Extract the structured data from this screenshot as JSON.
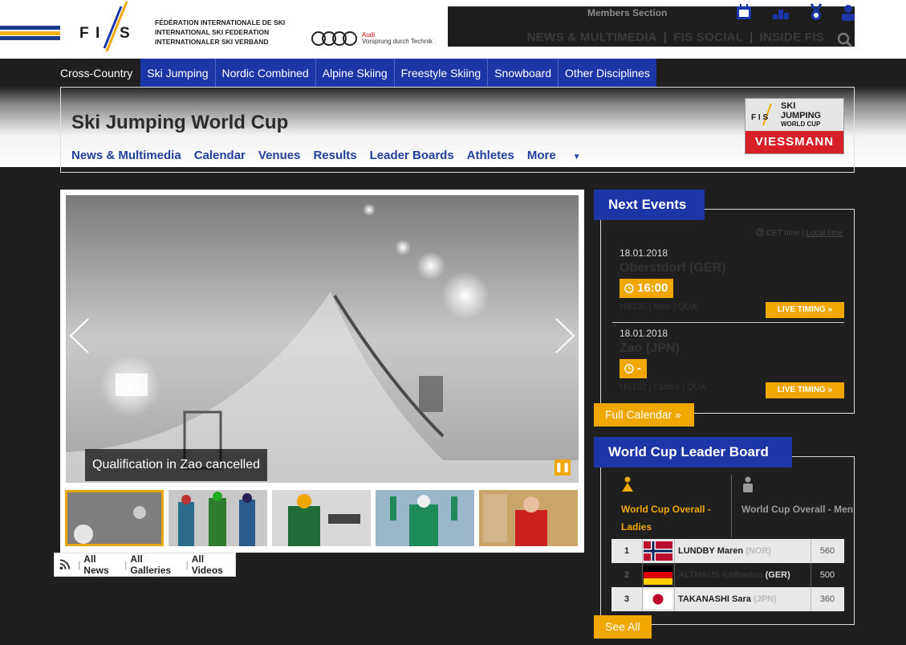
{
  "header": {
    "fis_lines": [
      "FÉDÉRATION INTERNATIONALE DE SKI",
      "INTERNATIONAL SKI FEDERATION",
      "INTERNATIONALER SKI VERBAND"
    ],
    "audi_name": "Audi",
    "audi_tagline": "Vorsprung durch Technik",
    "members_label": "Members Section",
    "top_nav": [
      "NEWS & MULTIMEDIA",
      "FIS SOCIAL",
      "INSIDE FIS"
    ],
    "top_icons": [
      "calendar-icon",
      "podium-icon",
      "medal-icon",
      "user-icon"
    ]
  },
  "disciplines": [
    "Cross-Country",
    "Ski Jumping",
    "Nordic Combined",
    "Alpine Skiing",
    "Freestyle Skiing",
    "Snowboard",
    "Other Disciplines"
  ],
  "series": {
    "title": "Ski Jumping World Cup",
    "nav": [
      "News & Multimedia",
      "Calendar",
      "Venues",
      "Results",
      "Leader Boards",
      "Athletes",
      "More"
    ],
    "sponsor": {
      "line1": "SKI",
      "line2": "JUMPING",
      "line3": "WORLD CUP",
      "brand": "VIESSMANN"
    }
  },
  "slider": {
    "caption": "Qualification in Zao cancelled",
    "links": [
      "All News",
      "All Galleries",
      "All Videos"
    ]
  },
  "next_events": {
    "title": "Next Events",
    "cet": "CET time",
    "local": "Local time",
    "events": [
      {
        "date": "18.01.2018",
        "place": "Oberstdorf (GER)",
        "time": "16:00",
        "meta": "HS235 | Men | QUA",
        "live": "LIVE TIMING »"
      },
      {
        "date": "18.01.2018",
        "place": "Zao (JPN)",
        "time": "-",
        "meta": "HS102 | Ladies | QUA",
        "live": "LIVE TIMING »"
      }
    ],
    "full_calendar": "Full Calendar »"
  },
  "leaderboard": {
    "title": "World Cup Leader Board",
    "tab_ladies": "World Cup Overall - Ladies",
    "tab_men": "World Cup Overall - Men",
    "rows": [
      {
        "rank": "1",
        "name": "LUNDBY Maren",
        "nat": "(NOR)",
        "points": "560"
      },
      {
        "rank": "2",
        "name": "ALTHAUS Katharina",
        "nat": "(GER)",
        "points": "500"
      },
      {
        "rank": "3",
        "name": "TAKANASHI Sara",
        "nat": "(JPN)",
        "points": "360"
      }
    ],
    "see_all": "See All"
  },
  "colors": {
    "brand_blue": "#1c36a8",
    "accent_gold": "#f0a800",
    "dark": "#1f1f1f"
  }
}
